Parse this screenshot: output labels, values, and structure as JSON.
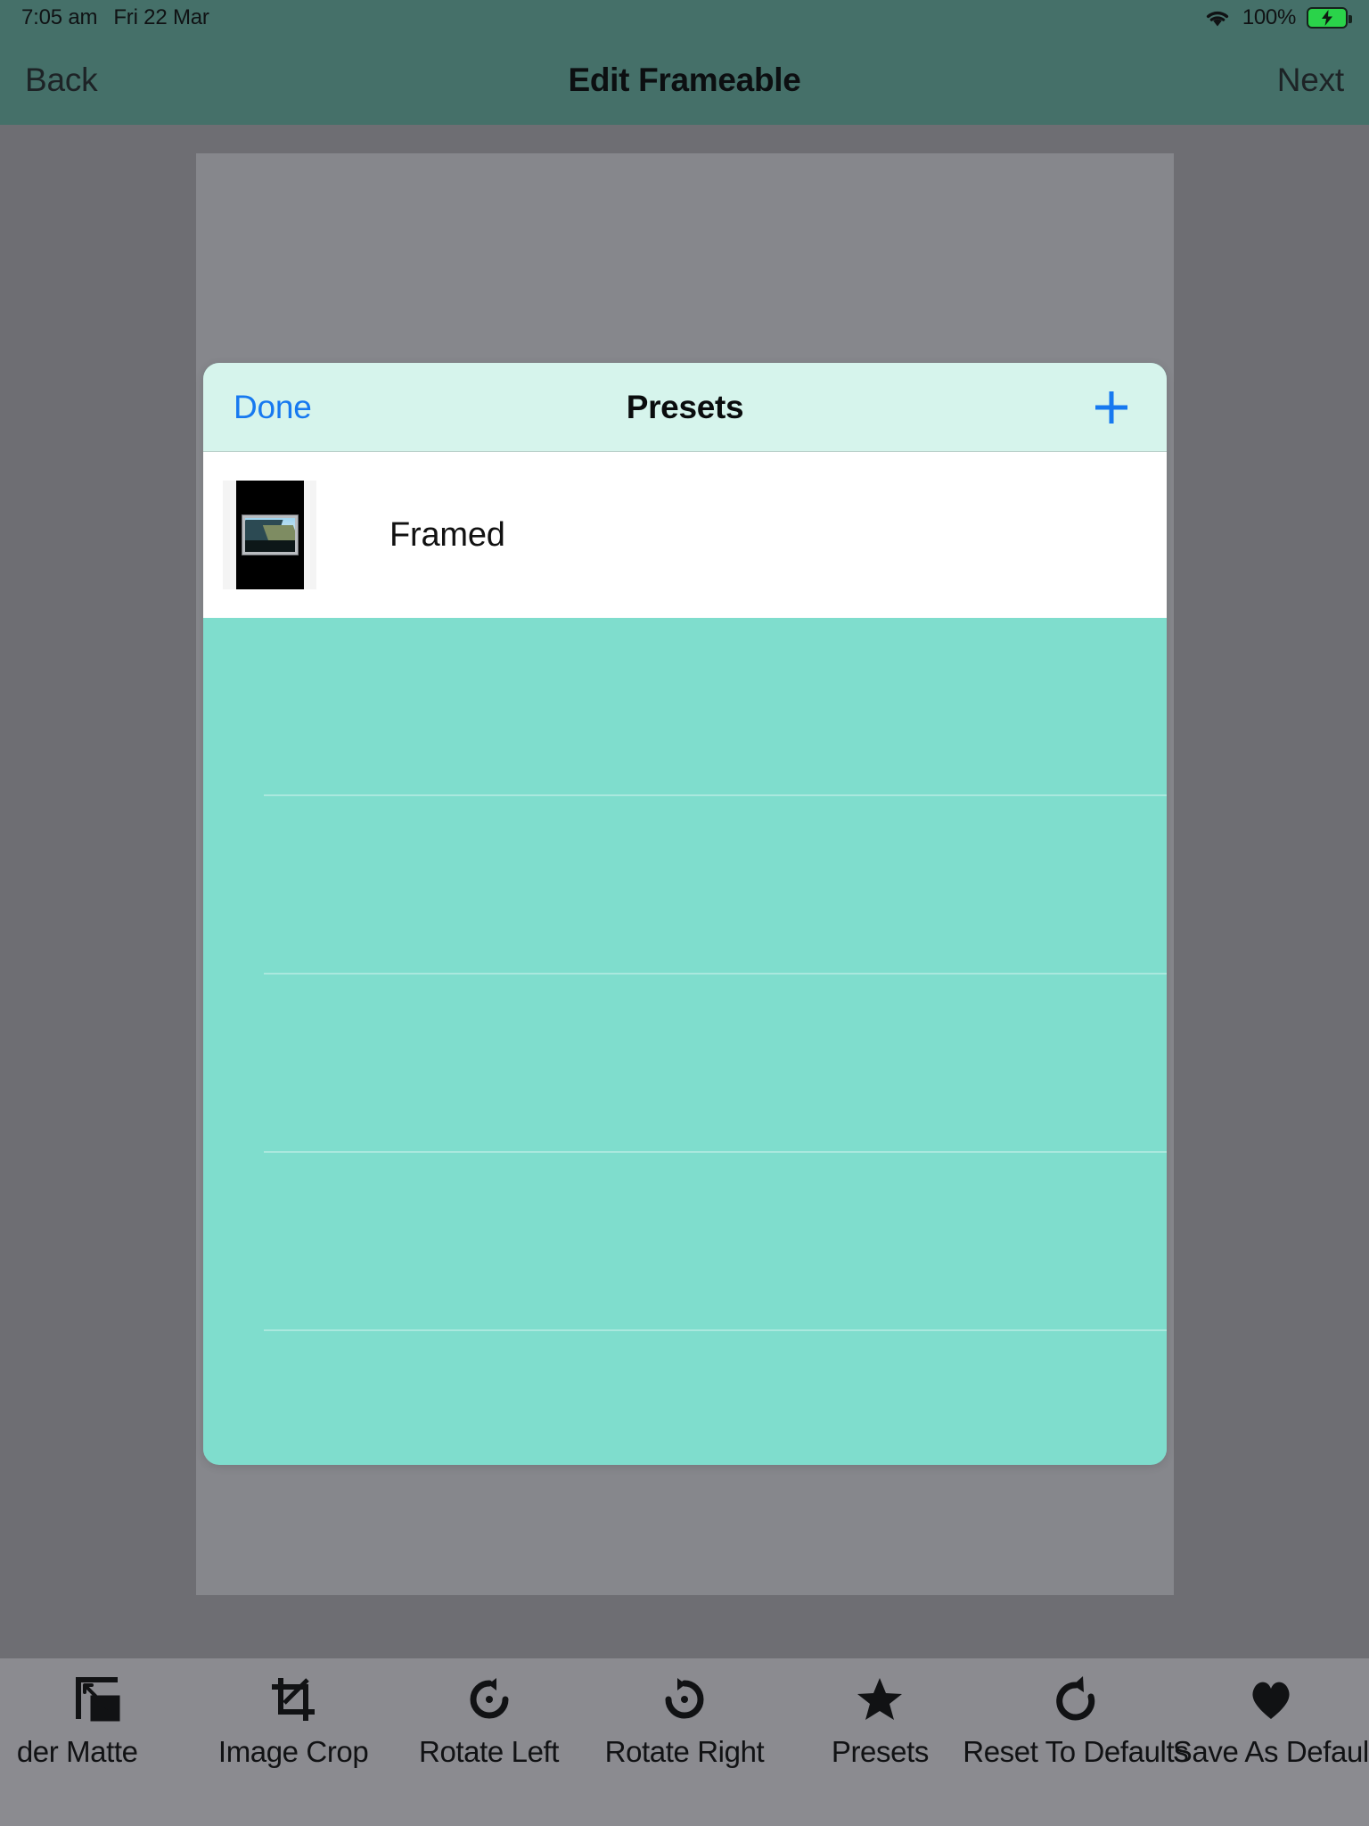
{
  "status_bar": {
    "time": "7:05 am",
    "date": "Fri 22 Mar",
    "wifi_icon": "wifi-icon",
    "battery_percent": "100%",
    "battery_icon": "battery-charging-icon",
    "battery_color": "#2ad34a"
  },
  "nav_bar": {
    "back_label": "Back",
    "title": "Edit Frameable",
    "next_label": "Next",
    "background_color": "#457069"
  },
  "modal": {
    "done_label": "Done",
    "title": "Presets",
    "add_icon": "plus-icon",
    "header_background": "#d6f4ec",
    "body_background": "#7fddcd",
    "presets": [
      {
        "label": "Framed",
        "thumbnail_icon": "framed-photo-thumbnail"
      }
    ]
  },
  "toolbar": {
    "background_color": "#8b8b90",
    "items": [
      {
        "label": "der Matte",
        "icon": "border-matte-icon"
      },
      {
        "label": "Image Crop",
        "icon": "crop-icon"
      },
      {
        "label": "Rotate Left",
        "icon": "rotate-left-icon"
      },
      {
        "label": "Rotate Right",
        "icon": "rotate-right-icon"
      },
      {
        "label": "Presets",
        "icon": "star-icon"
      },
      {
        "label": "Reset To Defaults",
        "icon": "reset-icon"
      },
      {
        "label": "Save As Defaults",
        "icon": "heart-icon"
      }
    ]
  }
}
